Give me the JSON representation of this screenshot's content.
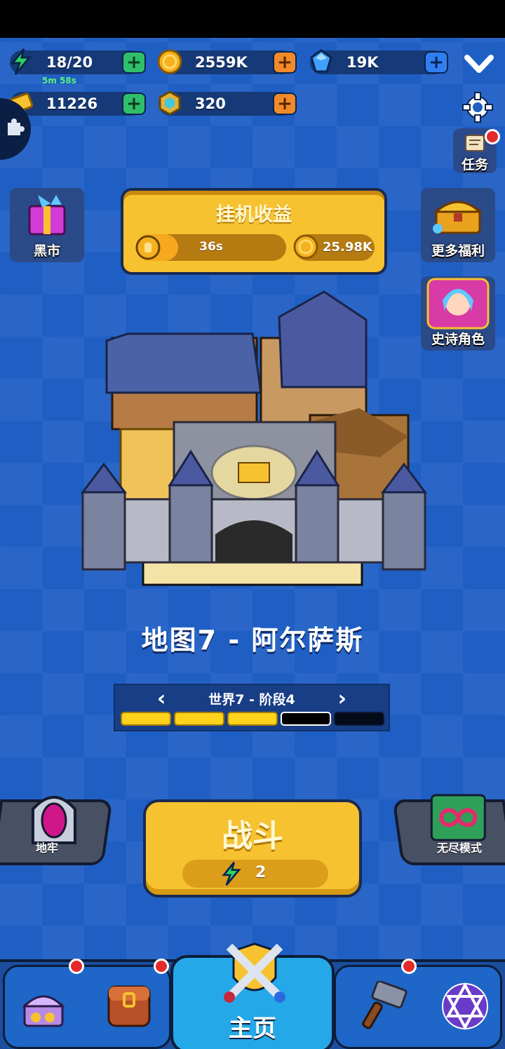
{
  "resources": {
    "energy": {
      "value": "18/20",
      "timer": "5m 58s",
      "icon": "lightning-icon"
    },
    "gold": {
      "value": "2559K",
      "icon": "gold-coin-icon"
    },
    "gems": {
      "value": "19K",
      "icon": "blue-gem-icon"
    },
    "tickets": {
      "value": "11226",
      "icon": "ticket-icon"
    },
    "crystals": {
      "value": "320",
      "icon": "hex-crystal-icon"
    }
  },
  "buttons": {
    "tasks": "任务",
    "black_market": "黑市",
    "more_benefits": "更多福利",
    "epic_hero": "史诗角色"
  },
  "idle": {
    "title": "挂机收益",
    "timer": "36s",
    "progress": 0.28,
    "gold": "25.98K"
  },
  "map": {
    "title": "地图7 - 阿尔萨斯",
    "stage_label": "世界7 - 阶段4",
    "stages_total": 5,
    "stage_current": 4
  },
  "modes": {
    "dungeon": "地牢",
    "battle": "战斗",
    "battle_cost": "2",
    "endless": "无尽模式"
  },
  "nav": {
    "home": "主页"
  },
  "colors": {
    "background": "#1f5fc4",
    "accent_yellow": "#f6c230",
    "dark_outline": "#1a2a52",
    "badge_red": "#e32b2b"
  }
}
